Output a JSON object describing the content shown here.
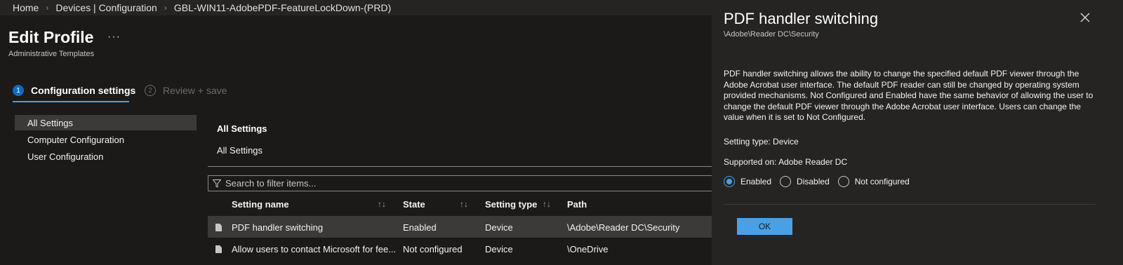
{
  "breadcrumb": [
    "Home",
    "Devices | Configuration",
    "GBL-WIN11-AdobePDF-FeatureLockDown-(PRD)"
  ],
  "header": {
    "title": "Edit Profile",
    "more": "···",
    "subtitle": "Administrative Templates"
  },
  "steps": [
    {
      "num": "1",
      "label": "Configuration settings",
      "active": true
    },
    {
      "num": "2",
      "label": "Review + save",
      "active": false
    }
  ],
  "sidebar": {
    "items": [
      {
        "label": "All Settings",
        "selected": true
      },
      {
        "label": "Computer Configuration",
        "selected": false
      },
      {
        "label": "User Configuration",
        "selected": false
      }
    ]
  },
  "main": {
    "heading": "All Settings",
    "subheading": "All Settings",
    "search_placeholder": "Search to filter items...",
    "columns": [
      "Setting name",
      "State",
      "Setting type",
      "Path"
    ],
    "sort_icon": "↑↓",
    "rows": [
      {
        "name": "PDF handler switching",
        "state": "Enabled",
        "type": "Device",
        "path": "\\Adobe\\Reader DC\\Security",
        "selected": true
      },
      {
        "name": "Allow users to contact Microsoft for fee...",
        "state": "Not configured",
        "type": "Device",
        "path": "\\OneDrive",
        "selected": false
      }
    ]
  },
  "panel": {
    "title": "PDF handler switching",
    "path": "\\Adobe\\Reader DC\\Security",
    "description": "PDF handler switching allows the ability to change the specified default PDF viewer through the Adobe Acrobat user interface. The default PDF reader can still be changed by operating system provided mechanisms. Not Configured and Enabled have the same behavior of allowing the user to change the default PDF viewer through the Adobe Acrobat user interface. Users can change the value when it is set to Not Configured.",
    "setting_type": "Setting type: Device",
    "supported_on": "Supported on: Adobe Reader DC",
    "options": [
      "Enabled",
      "Disabled",
      "Not configured"
    ],
    "selected_option": "Enabled",
    "ok_label": "OK"
  },
  "colors": {
    "accent": "#4aa0e6",
    "background": "#1b1a19",
    "panel": "#252423",
    "selection": "#3b3a39"
  },
  "icons": [
    "chevron-right-icon",
    "ellipsis-icon",
    "filter-icon",
    "sort-icon",
    "document-icon",
    "close-icon"
  ]
}
